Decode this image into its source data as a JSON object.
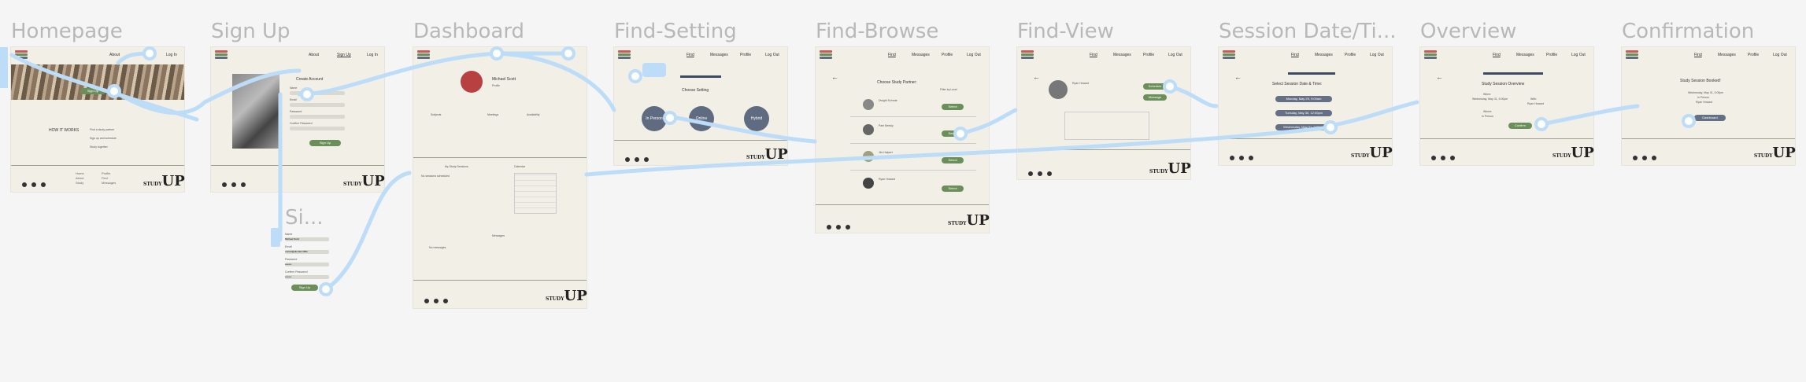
{
  "frames": {
    "homepage": {
      "title": "Homepage",
      "nav": [
        "About",
        "Log In"
      ],
      "hero_btn": "Sign Up",
      "how": "HOW IT WORKS",
      "steps": [
        "Find a study partner",
        "Sign up and schedule",
        "Study together"
      ],
      "links": [
        "Home",
        "About",
        "Study"
      ],
      "links2": [
        "Profile",
        "Find",
        "Messages"
      ]
    },
    "signup": {
      "title": "Sign Up",
      "nav": [
        "About",
        "Sign Up",
        "Log In"
      ],
      "heading": "Create Account",
      "labels": [
        "Name",
        "Email",
        "Password",
        "Confirm Password"
      ],
      "btn": "Sign Up"
    },
    "signup_mobile": {
      "title": "Si...",
      "labels": [
        "Name",
        "Email",
        "Password",
        "Confirm Password"
      ],
      "values": [
        "Michael Scott",
        "mscott@dundermifflin",
        "••••••••",
        "••••••••"
      ],
      "btn": "Sign Up"
    },
    "dashboard": {
      "title": "Dashboard",
      "name": "Michael Scott",
      "sub": "Profile",
      "cols": [
        "Subjects",
        "Meetings",
        "Availability"
      ],
      "sessions": "My Study Sessions",
      "calendar": "Calendar",
      "messages": "Messages",
      "no_sessions": "No sessions scheduled",
      "no_msgs": "No messages"
    },
    "find_setting": {
      "title": "Find-Setting",
      "nav": [
        "Find",
        "Messages",
        "Profile",
        "Log Out"
      ],
      "heading": "Choose Setting",
      "options": [
        "In Person",
        "Online",
        "Hybrid"
      ]
    },
    "find_browse": {
      "title": "Find-Browse",
      "nav": [
        "Find",
        "Messages",
        "Profile",
        "Log Out"
      ],
      "heading": "Choose Study Partner:",
      "filter": "Filter by Level",
      "btn": "Select",
      "partners": [
        "Dwight Schrute",
        "Pam Beesly",
        "Jim Halpert",
        "Ryan Howard"
      ]
    },
    "find_view": {
      "title": "Find-View",
      "nav": [
        "Find",
        "Messages",
        "Profile",
        "Log Out"
      ],
      "name": "Ryan Howard",
      "btn1": "Schedule",
      "btn2": "Message"
    },
    "session": {
      "title": "Session Date/Ti...",
      "nav": [
        "Find",
        "Messages",
        "Profile",
        "Log Out"
      ],
      "heading": "Select Session Date & Time:",
      "slots": [
        "Monday, May 29, 9:00am",
        "Tuesday, May 30, 12:00pm",
        "Wednesday, May 31, 3:00pm"
      ]
    },
    "overview": {
      "title": "Overview",
      "nav": [
        "Find",
        "Messages",
        "Profile",
        "Log Out"
      ],
      "heading": "Study Session Overview",
      "when": "When:",
      "when_val": "Wednesday, May 31, 3:00pm",
      "with": "With:",
      "with_val": "Ryan Howard",
      "where": "Where:",
      "where_val": "In Person",
      "btn": "Confirm"
    },
    "confirmation": {
      "title": "Confirmation",
      "nav": [
        "Find",
        "Messages",
        "Profile",
        "Log Out"
      ],
      "heading": "Study Session Booked!",
      "line1": "Wednesday, May 31, 3:00pm",
      "line2": "In Person",
      "line3": "Ryan Howard",
      "btn": "Dashboard"
    }
  },
  "brand": {
    "name": "UP",
    "prefix": "STUDY"
  },
  "colors": {
    "bg": "#f5f5f5",
    "frame": "#f1efe6",
    "flow": "#bcdcf7",
    "green": "#6b8f5a",
    "slate": "#667085"
  }
}
